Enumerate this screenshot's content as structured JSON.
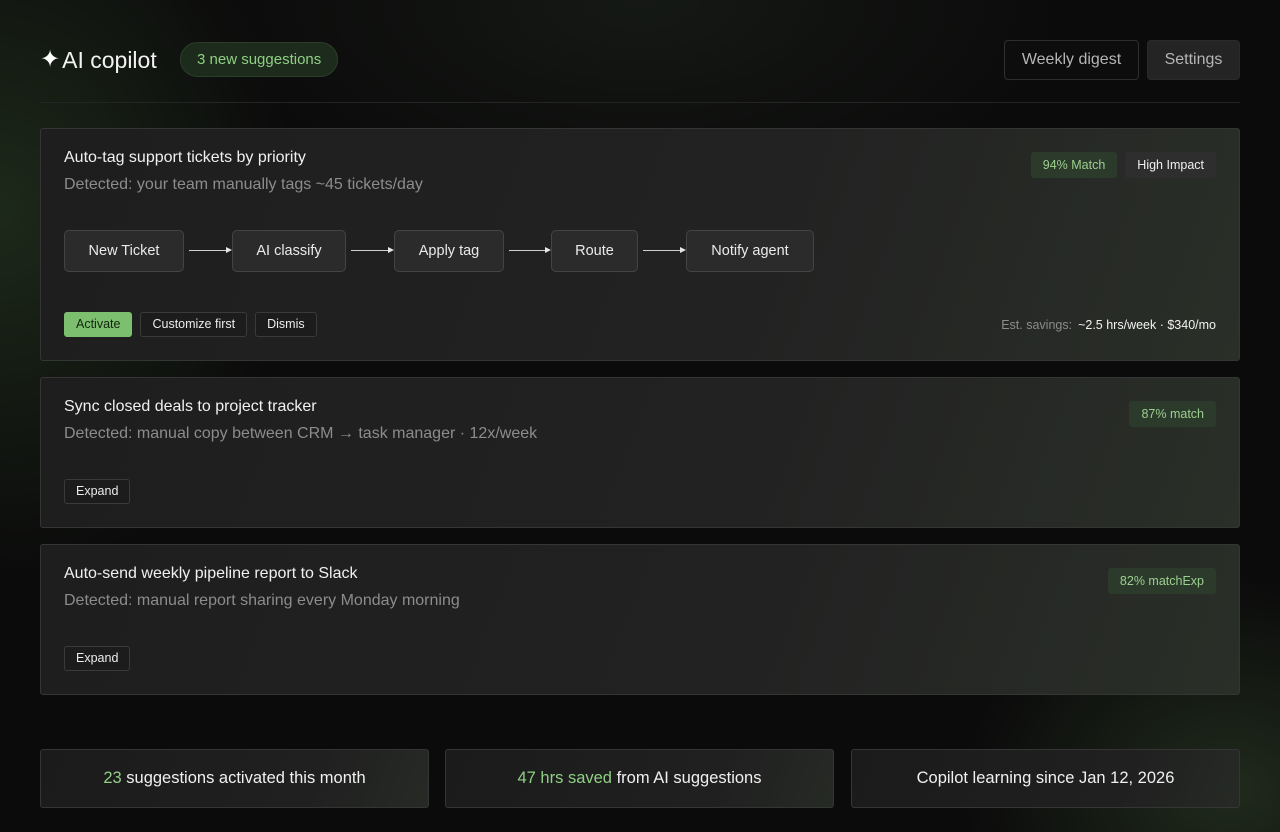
{
  "header": {
    "spark_icon": "✦",
    "title": "AI copilot",
    "badge": "3 new suggestions",
    "buttons": {
      "weekly_digest": "Weekly digest",
      "settings": "Settings"
    }
  },
  "suggestions": [
    {
      "title": "Auto-tag support tickets by priority",
      "detected": "Detected: your team manually tags ~45 tickets/day",
      "tags": [
        "94% Match",
        "High Impact"
      ],
      "flow": [
        "New Ticket",
        "AI classify",
        "Apply tag",
        "Route",
        "Notify agent"
      ],
      "actions": {
        "activate": "Activate",
        "customize": "Customize first",
        "dismiss": "Dismis"
      },
      "savings_label": "Est. savings:",
      "savings_value": "~2.5 hrs/week · $340/mo"
    },
    {
      "title": "Sync closed deals to project tracker",
      "detected": "Detected: manual copy between CRM → task manager · 12x/week",
      "tag": "87% match",
      "expand": "Expand"
    },
    {
      "title": "Auto-send weekly pipeline report to Slack",
      "detected": "Detected: manual report sharing every Monday morning",
      "tag": "82% matchExp",
      "expand": "Expand"
    }
  ],
  "stats": [
    {
      "highlight": "23",
      "text": " suggestions activated this month"
    },
    {
      "highlight": "47 hrs saved",
      "text": " from AI suggestions"
    },
    {
      "highlight": "",
      "text": "Copilot learning since Jan 12, 2026"
    }
  ],
  "colors": {
    "accent": "#7bbf6f",
    "accent_text": "#8fcf84",
    "background": "#0b0b0b",
    "card": "#1e1e1e"
  }
}
